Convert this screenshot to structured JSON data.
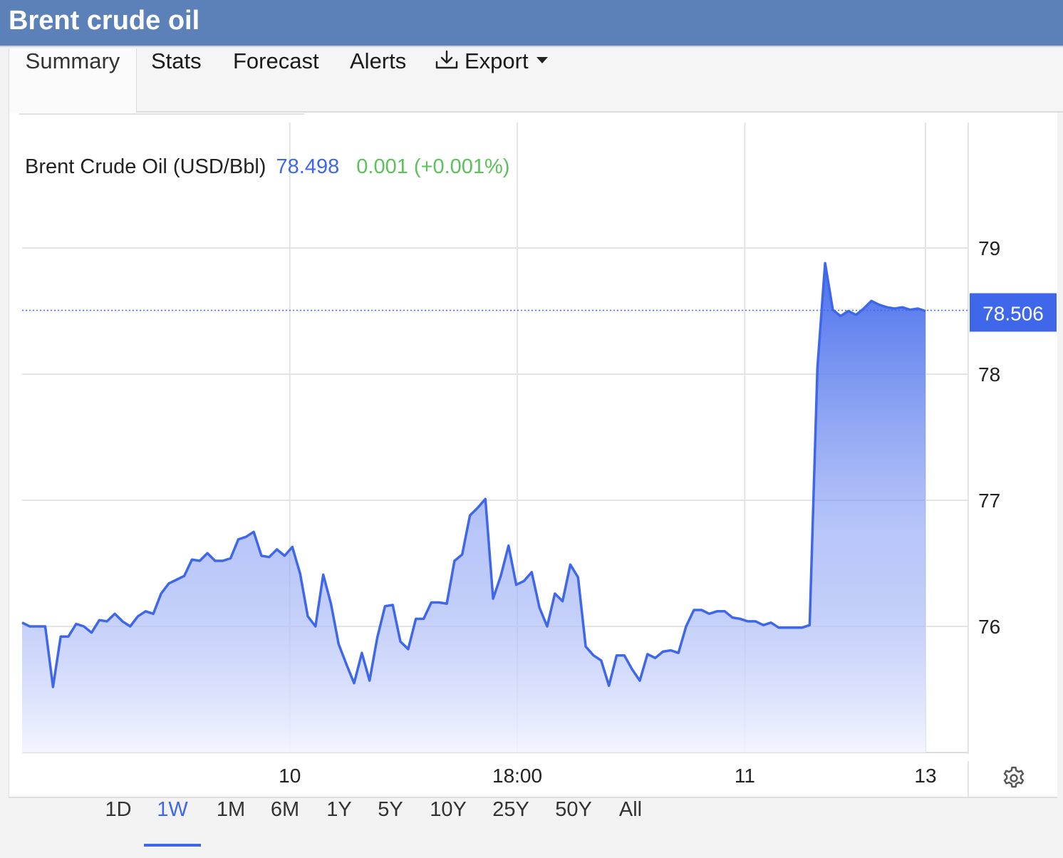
{
  "header": {
    "title": "Brent crude oil"
  },
  "tabs": [
    {
      "label": "Summary",
      "active": true
    },
    {
      "label": "Stats",
      "active": false
    },
    {
      "label": "Forecast",
      "active": false
    },
    {
      "label": "Alerts",
      "active": false
    },
    {
      "label": "Export",
      "active": false,
      "icon": "download-icon",
      "has_dropdown": true
    }
  ],
  "legend": {
    "name": "Brent Crude Oil (USD/Bbl)",
    "price": "78.498",
    "change": "0.001 (+0.001%)"
  },
  "ranges": [
    {
      "label": "1D",
      "active": false
    },
    {
      "label": "1W",
      "active": true
    },
    {
      "label": "1M",
      "active": false
    },
    {
      "label": "6M",
      "active": false
    },
    {
      "label": "1Y",
      "active": false
    },
    {
      "label": "5Y",
      "active": false
    },
    {
      "label": "10Y",
      "active": false
    },
    {
      "label": "25Y",
      "active": false
    },
    {
      "label": "50Y",
      "active": false
    },
    {
      "label": "All",
      "active": false
    }
  ],
  "chart_data": {
    "type": "area",
    "title": "",
    "xlabel": "",
    "ylabel": "",
    "ylim": [
      75,
      80
    ],
    "yticks": [
      76,
      77,
      78,
      79
    ],
    "xticks": [
      {
        "label": "10",
        "at": 40
      },
      {
        "label": "18:00",
        "at": 74
      },
      {
        "label": "11",
        "at": 108
      },
      {
        "label": "13",
        "at": 135
      }
    ],
    "last_value_label": "78.506",
    "last_value": 78.506,
    "grid": true,
    "colors": {
      "line": "#3f67ea",
      "fill_top": "#3f67ea",
      "fill_bottom": "#f2f4fe",
      "grid": "#e4e4e4",
      "tag_bg": "#3f67ea"
    },
    "x": [
      0,
      1,
      2,
      3,
      4,
      5,
      6,
      7,
      8,
      9,
      10,
      11,
      12,
      13,
      14,
      15,
      16,
      17,
      18,
      19,
      20,
      21,
      22,
      23,
      24,
      25,
      26,
      27,
      28,
      29,
      30,
      31,
      32,
      33,
      34,
      35,
      36,
      37,
      38,
      39,
      40,
      41,
      42,
      43,
      44,
      45,
      46,
      47,
      48,
      49,
      50,
      51,
      52,
      53,
      54,
      55,
      56,
      57,
      58,
      59,
      60,
      61,
      62,
      63,
      64,
      65,
      66,
      67,
      68,
      69,
      70,
      71,
      72,
      73,
      74,
      75,
      76,
      77,
      78,
      79,
      80,
      81,
      82,
      83,
      84,
      85,
      86,
      87,
      88,
      89,
      90,
      91,
      92,
      93,
      94,
      95,
      96,
      97,
      98,
      99,
      100,
      101,
      102,
      103,
      104,
      105,
      106,
      107,
      108,
      109,
      110,
      111,
      112,
      113,
      114,
      115,
      116,
      117,
      118,
      119,
      120,
      121,
      122,
      123,
      124,
      125,
      126,
      127,
      128,
      129,
      130,
      131,
      132,
      133,
      134,
      135,
      136,
      137,
      138,
      139,
      140,
      141,
      142,
      143,
      144,
      145,
      146,
      147,
      148,
      149,
      150,
      151,
      152,
      153,
      154,
      155,
      156
    ],
    "values": [
      76.03,
      76.0,
      76.0,
      76.0,
      75.52,
      75.92,
      75.92,
      76.02,
      76.0,
      75.95,
      76.05,
      76.04,
      76.1,
      76.04,
      76.0,
      76.08,
      76.12,
      76.1,
      76.26,
      76.34,
      76.37,
      76.4,
      76.53,
      76.52,
      76.58,
      76.52,
      76.52,
      76.54,
      76.69,
      76.71,
      76.75,
      76.56,
      76.55,
      76.61,
      76.56,
      76.63,
      76.42,
      76.08,
      76.0,
      76.41,
      76.18,
      75.86,
      75.7,
      75.55,
      75.79,
      75.57,
      75.91,
      76.16,
      76.17,
      75.88,
      75.82,
      76.06,
      76.06,
      76.19,
      76.19,
      76.18,
      76.52,
      76.57,
      76.88,
      76.94,
      77.01,
      76.22,
      76.4,
      76.64,
      76.33,
      76.36,
      76.43,
      76.15,
      76.0,
      76.26,
      76.2,
      76.49,
      76.39,
      75.84,
      75.77,
      75.73,
      75.53,
      75.77,
      75.77,
      75.66,
      75.57,
      75.78,
      75.75,
      75.8,
      75.81,
      75.79,
      76.0,
      76.13,
      76.13,
      76.1,
      76.12,
      76.12,
      76.07,
      76.06,
      76.04,
      76.04,
      76.01,
      76.03,
      75.99,
      75.99,
      75.99,
      75.99,
      76.01,
      78.05,
      78.88,
      78.51,
      78.46,
      78.5,
      78.47,
      78.52,
      78.58,
      78.55,
      78.53,
      78.52,
      78.53,
      78.51,
      78.52,
      78.5,
      78.51,
      78.52,
      78.52,
      78.52,
      78.52,
      78.51,
      78.51,
      78.51,
      78.51,
      78.51,
      78.51,
      78.51,
      78.51,
      78.51,
      78.51,
      78.51,
      78.51,
      78.506
    ],
    "series_end_index": 117
  }
}
